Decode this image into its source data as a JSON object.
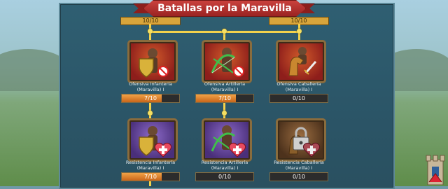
{
  "title": "Batallas por la Maravilla",
  "top_progress": {
    "left": "10/10",
    "right": "10/10"
  },
  "cards": [
    {
      "name": "Ofensiva Infantería",
      "sub": "(Maravilla) I",
      "progress": "7/10",
      "fill": 0.7,
      "theme": "red"
    },
    {
      "name": "Ofensiva Artillería",
      "sub": "(Maravilla) I",
      "progress": "7/10",
      "fill": 0.7,
      "theme": "red"
    },
    {
      "name": "Ofensiva Caballería",
      "sub": "(Maravilla) I",
      "progress": "0/10",
      "fill": 0.0,
      "theme": "red"
    },
    {
      "name": "Resistencia Infantería",
      "sub": "(Maravilla) I",
      "progress": "7/10",
      "fill": 0.7,
      "theme": "purple"
    },
    {
      "name": "Resistencia Artillería",
      "sub": "(Maravilla) I",
      "progress": "0/10",
      "fill": 0.0,
      "theme": "purple"
    },
    {
      "name": "Resistencia Caballería",
      "sub": "(Maravilla) I",
      "progress": "0/10",
      "fill": 0.0,
      "theme": "brown"
    }
  ],
  "icons": [
    "shield-icon",
    "bow-icon",
    "horse-icon",
    "lock-icon",
    "heart-cross-icon",
    "no-symbol-icon",
    "castle-tower-icon"
  ]
}
